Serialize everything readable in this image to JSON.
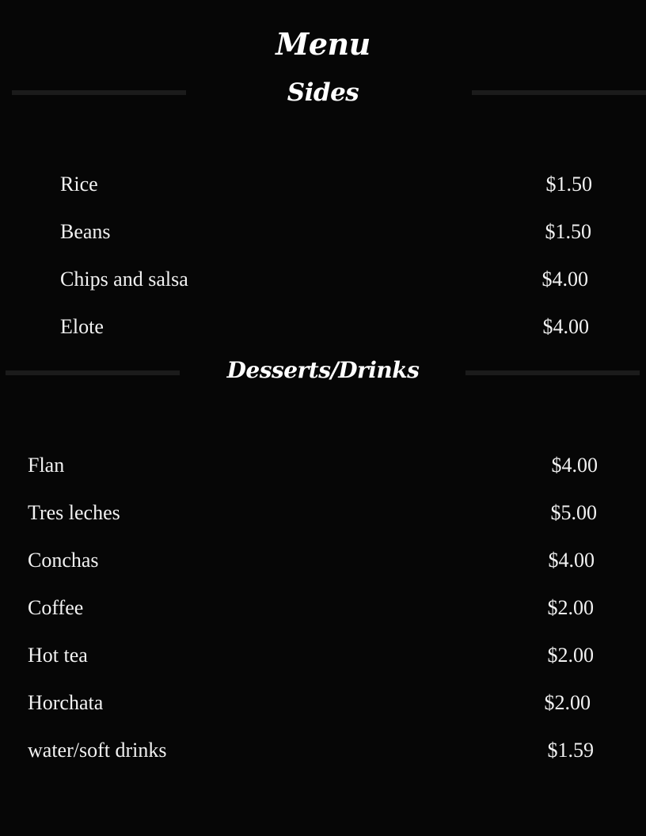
{
  "menu_title": "Menu",
  "sections": [
    {
      "title": "Sides",
      "items": [
        {
          "name": "Rice",
          "price": "$1.50"
        },
        {
          "name": "Beans",
          "price": "$1.50"
        },
        {
          "name": "Chips and salsa",
          "price": "$4.00"
        },
        {
          "name": "Elote",
          "price": "$4.00"
        }
      ]
    },
    {
      "title": "Desserts/Drinks",
      "items": [
        {
          "name": "Flan",
          "price": "$4.00"
        },
        {
          "name": "Tres leches",
          "price": "$5.00"
        },
        {
          "name": "Conchas",
          "price": "$4.00"
        },
        {
          "name": "Coffee",
          "price": "$2.00"
        },
        {
          "name": "Hot tea",
          "price": "$2.00"
        },
        {
          "name": "Horchata",
          "price": "$2.00"
        },
        {
          "name": "water/soft drinks",
          "price": "$1.59"
        }
      ]
    }
  ],
  "colors": {
    "background": "#060606",
    "text": "#f5f5f5",
    "divider": "#1b1b1b"
  }
}
